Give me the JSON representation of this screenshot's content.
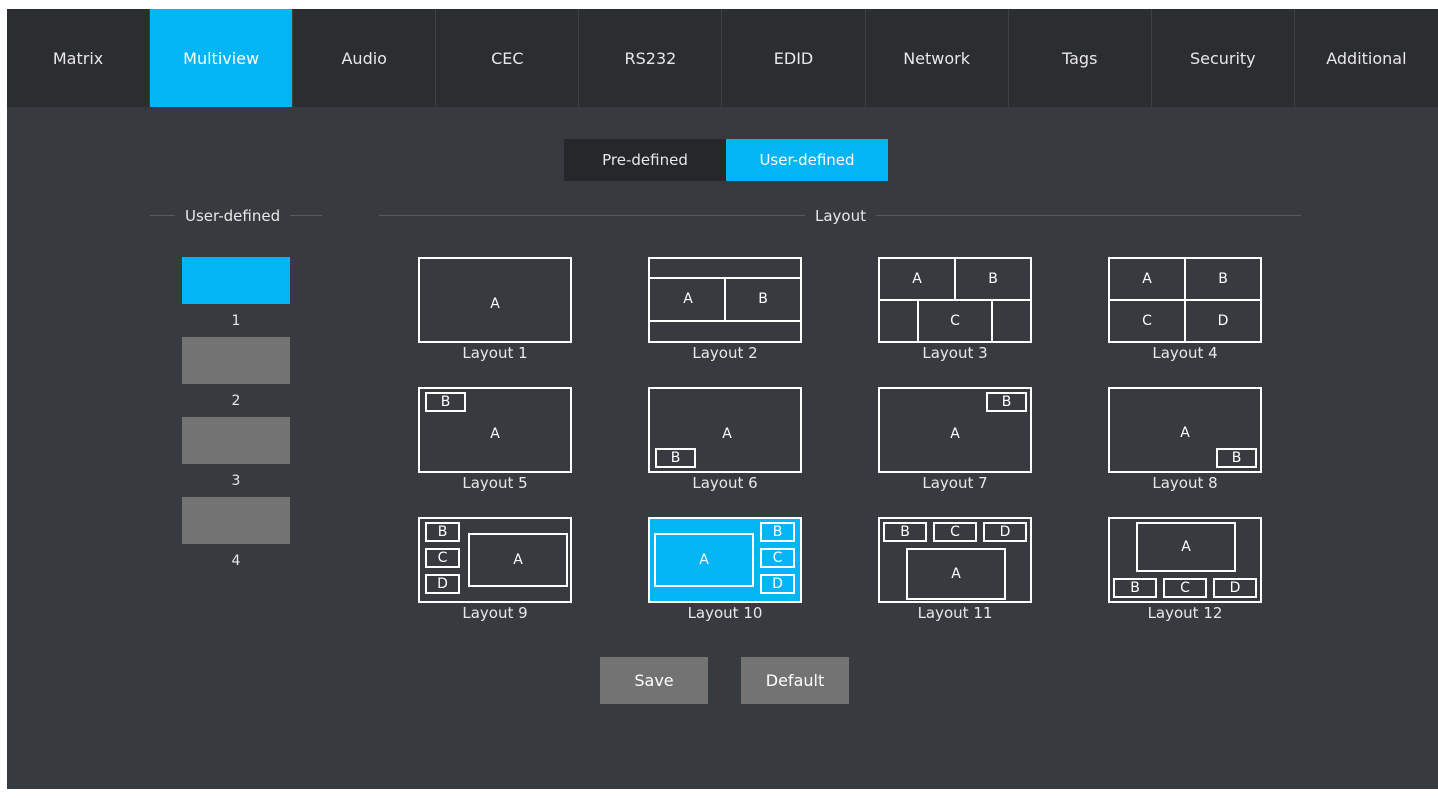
{
  "tabs": [
    {
      "label": "Matrix",
      "active": false
    },
    {
      "label": "Multiview",
      "active": true
    },
    {
      "label": "Audio",
      "active": false
    },
    {
      "label": "CEC",
      "active": false
    },
    {
      "label": "RS232",
      "active": false
    },
    {
      "label": "EDID",
      "active": false
    },
    {
      "label": "Network",
      "active": false
    },
    {
      "label": "Tags",
      "active": false
    },
    {
      "label": "Security",
      "active": false
    },
    {
      "label": "Additional",
      "active": false
    }
  ],
  "mode_toggle": {
    "predefined_label": "Pre-defined",
    "userdefined_label": "User-defined",
    "selected": "User-defined"
  },
  "user_defined": {
    "title": "User-defined",
    "slots": [
      {
        "number": "1",
        "active": true
      },
      {
        "number": "2",
        "active": false
      },
      {
        "number": "3",
        "active": false
      },
      {
        "number": "4",
        "active": false
      }
    ]
  },
  "layout_section": {
    "title": "Layout",
    "selected": "Layout 10",
    "layouts": [
      {
        "label": "Layout 1",
        "regions": [
          "A"
        ]
      },
      {
        "label": "Layout 2",
        "regions": [
          "A",
          "B"
        ]
      },
      {
        "label": "Layout 3",
        "regions": [
          "A",
          "B",
          "C"
        ]
      },
      {
        "label": "Layout 4",
        "regions": [
          "A",
          "B",
          "C",
          "D"
        ]
      },
      {
        "label": "Layout 5",
        "regions": [
          "A",
          "B"
        ]
      },
      {
        "label": "Layout 6",
        "regions": [
          "A",
          "B"
        ]
      },
      {
        "label": "Layout 7",
        "regions": [
          "A",
          "B"
        ]
      },
      {
        "label": "Layout 8",
        "regions": [
          "A",
          "B"
        ]
      },
      {
        "label": "Layout 9",
        "regions": [
          "A",
          "B",
          "C",
          "D"
        ]
      },
      {
        "label": "Layout 10",
        "regions": [
          "A",
          "B",
          "C",
          "D"
        ]
      },
      {
        "label": "Layout 11",
        "regions": [
          "A",
          "B",
          "C",
          "D"
        ]
      },
      {
        "label": "Layout 12",
        "regions": [
          "A",
          "B",
          "C",
          "D"
        ]
      }
    ]
  },
  "actions": {
    "save_label": "Save",
    "default_label": "Default"
  },
  "colors": {
    "accent": "#03b5f5",
    "nav_bg": "#2b2d31",
    "panel_bg": "#373a3f",
    "inactive_slot": "#737373"
  }
}
